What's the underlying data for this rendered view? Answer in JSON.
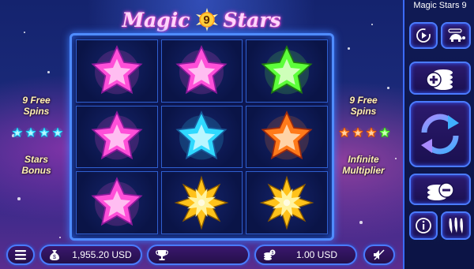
{
  "title": {
    "word1": "Magic",
    "number": "9",
    "word2": "Stars"
  },
  "window_title": "Magic Stars 9",
  "grid": {
    "rows": [
      [
        "pink-star",
        "pink-star",
        "green-star"
      ],
      [
        "pink-star",
        "teal-star",
        "orange-star"
      ],
      [
        "pink-star",
        "gold-burst",
        "gold-burst"
      ]
    ]
  },
  "left_feature": {
    "line1": "9 Free",
    "line2": "Spins",
    "line3": "Stars",
    "line4": "Bonus"
  },
  "right_feature": {
    "line1": "9 Free",
    "line2": "Spins",
    "line3": "Infinite",
    "line4": "Multiplier"
  },
  "balance": {
    "value": "1,955.20 USD",
    "icon": "money-bag-icon"
  },
  "win": {
    "value": "",
    "icon": "trophy-icon"
  },
  "bet": {
    "value": "1.00 USD",
    "icon": "coin-stack-icon"
  },
  "colors": {
    "pink": "#ff4fd8",
    "green": "#5dff3a",
    "teal": "#2fd9ff",
    "orange": "#ff7a1a",
    "gold": "#ffc21a",
    "accent": "#4a7bff"
  },
  "icons": {
    "menu": "hamburger-menu-icon",
    "sound": "sound-muted-icon",
    "autoplay": "autoplay-icon",
    "turbo": "turtle-icon",
    "bet_up": "bet-increase-icon",
    "spin": "spin-arrows-icon",
    "bet_down": "bet-decrease-icon",
    "info": "info-icon",
    "volatility": "chili-peppers-icon"
  }
}
